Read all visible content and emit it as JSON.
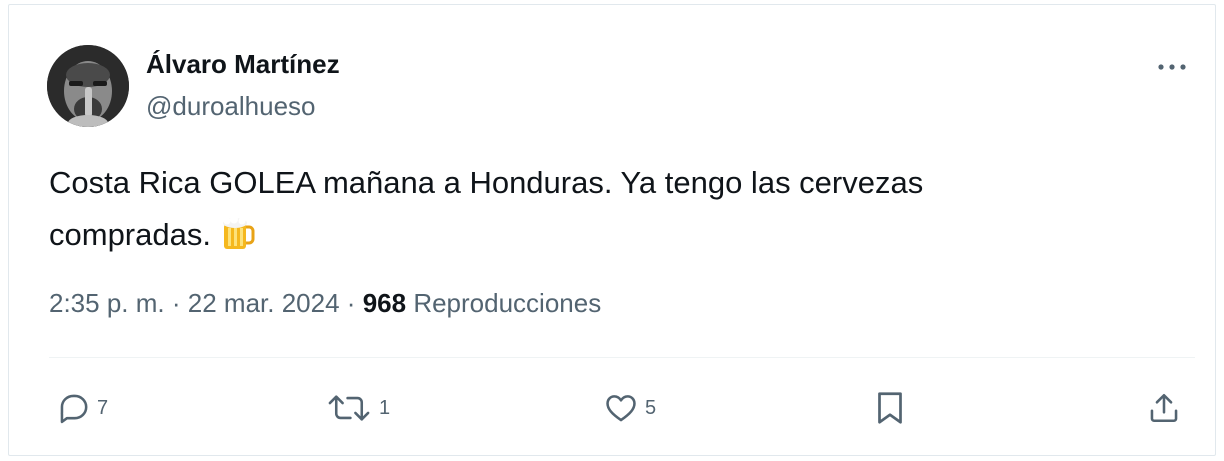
{
  "author": {
    "display_name": "Álvaro Martínez",
    "handle": "@duroalhueso"
  },
  "tweet": {
    "text_line1": "Costa Rica GOLEA mañana a Honduras. Ya tengo las cervezas",
    "text_line2": "compradas.",
    "emoji": "beer-mug-icon"
  },
  "meta": {
    "time": "2:35 p. m.",
    "separator": "·",
    "date": "22 mar. 2024",
    "views_count": "968",
    "views_label": "Reproducciones"
  },
  "actions": {
    "reply_count": "7",
    "retweet_count": "1",
    "like_count": "5"
  },
  "colors": {
    "text_primary": "#0f1419",
    "text_secondary": "#536471",
    "border": "#e1e8ed"
  }
}
